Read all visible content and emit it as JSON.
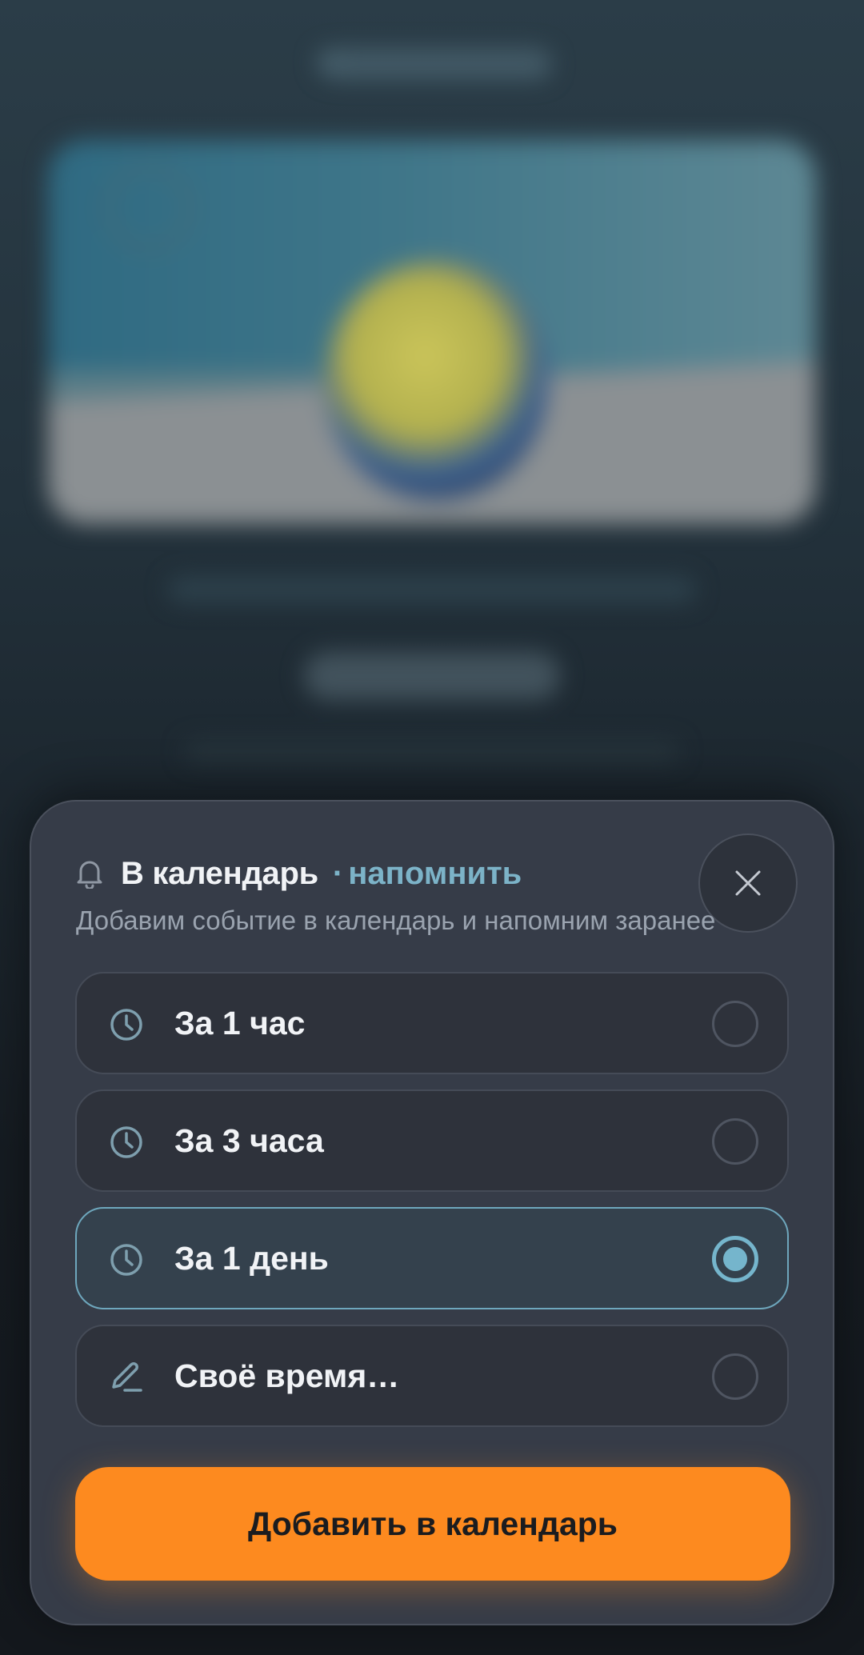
{
  "sheet": {
    "title": "В календарь",
    "separator": "·",
    "subtitle": "напомнить",
    "description": "Добавим событие в календарь и напомним заранее",
    "close_icon": "close-icon",
    "bell_icon": "bell-icon"
  },
  "options": [
    {
      "label": "За 1 час",
      "icon": "clock-icon",
      "selected": false
    },
    {
      "label": "За 3 часа",
      "icon": "clock-icon",
      "selected": false
    },
    {
      "label": "За 1 день",
      "icon": "clock-icon",
      "selected": true
    },
    {
      "label": "Своё время…",
      "icon": "pencil-icon",
      "selected": false
    }
  ],
  "cta": {
    "label": "Добавить в календарь"
  },
  "colors": {
    "accent": "#7cb3c8",
    "cta": "#fd8a1f",
    "sheet_bg": "#363c48"
  }
}
